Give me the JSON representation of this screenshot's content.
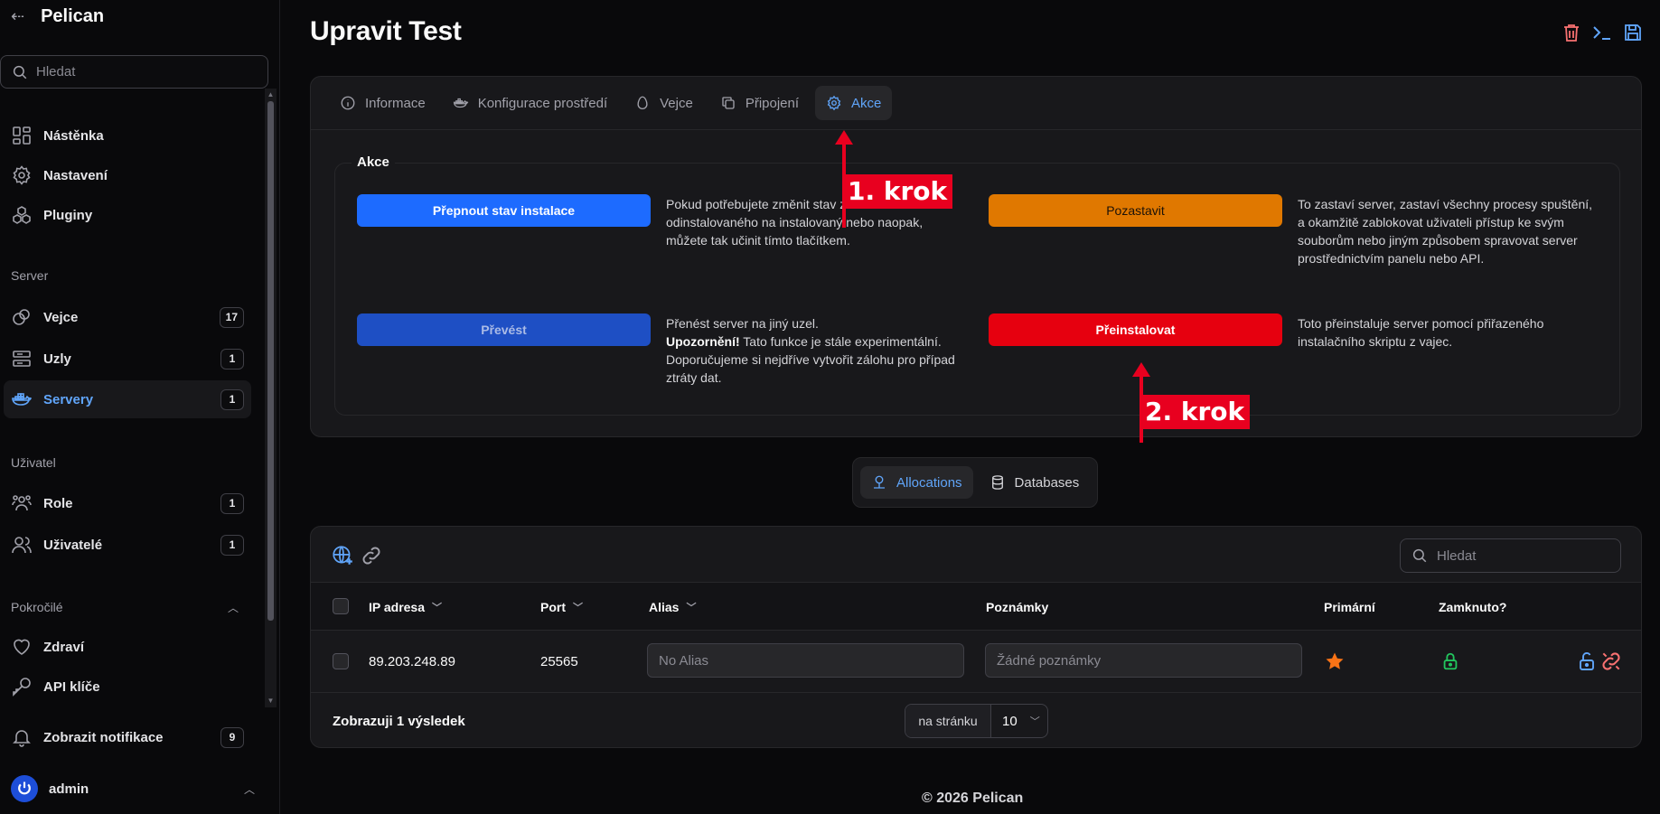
{
  "app": {
    "name": "Pelican"
  },
  "sidebar": {
    "search_placeholder": "Hledat",
    "items_top": [
      {
        "label": "Nástěnka",
        "icon": "dashboard-icon"
      },
      {
        "label": "Nastavení",
        "icon": "gear-icon"
      },
      {
        "label": "Pluginy",
        "icon": "plugins-icon"
      }
    ],
    "group_server": "Server",
    "items_server": [
      {
        "label": "Vejce",
        "badge": "17",
        "icon": "egg-icon"
      },
      {
        "label": "Uzly",
        "badge": "1",
        "icon": "server-stack-icon"
      },
      {
        "label": "Servery",
        "badge": "1",
        "icon": "docker-icon",
        "active": true
      }
    ],
    "group_user": "Uživatel",
    "items_user": [
      {
        "label": "Role",
        "badge": "1",
        "icon": "roles-icon"
      },
      {
        "label": "Uživatelé",
        "badge": "1",
        "icon": "users-icon"
      }
    ],
    "group_advanced": "Pokročilé",
    "items_advanced": [
      {
        "label": "Zdraví",
        "icon": "heart-icon"
      },
      {
        "label": "API klíče",
        "icon": "key-icon"
      }
    ],
    "notifications": {
      "label": "Zobrazit notifikace",
      "badge": "9"
    },
    "user": {
      "name": "admin"
    }
  },
  "page": {
    "title": "Upravit Test"
  },
  "tabs": [
    {
      "label": "Informace",
      "icon": "info-icon"
    },
    {
      "label": "Konfigurace prostředí",
      "icon": "docker-icon"
    },
    {
      "label": "Vejce",
      "icon": "egg-icon"
    },
    {
      "label": "Připojení",
      "icon": "copy-icon"
    },
    {
      "label": "Akce",
      "icon": "gear-icon",
      "active": true
    }
  ],
  "actions": {
    "legend": "Akce",
    "toggle_install": {
      "label": "Přepnout stav instalace",
      "desc": "Pokud potřebujete změnit stav z odinstalovaného na instalovaný nebo naopak, můžete tak učinit tímto tlačítkem."
    },
    "suspend": {
      "label": "Pozastavit",
      "desc": "To zastaví server, zastaví všechny procesy spuštění, a okamžitě zablokovat uživateli přístup ke svým souborům nebo jiným způsobem spravovat server prostřednictvím panelu nebo API."
    },
    "transfer": {
      "label": "Převést",
      "desc_line1": "Přenést server na jiný uzel.",
      "desc_warn": "Upozornění!",
      "desc_rest": " Tato funkce je stále experimentální. Doporučujeme si nejdříve vytvořit zálohu pro případ ztráty dat."
    },
    "reinstall": {
      "label": "Přeinstalovat",
      "desc": "Toto přeinstaluje server pomocí přiřazeného instalačního skriptu z vajec."
    }
  },
  "annotations": {
    "step1": "1. krok",
    "step2": "2. krok"
  },
  "relations": [
    {
      "label": "Allocations",
      "icon": "network-icon",
      "active": true
    },
    {
      "label": "Databases",
      "icon": "database-icon"
    }
  ],
  "table": {
    "search_placeholder": "Hledat",
    "columns": [
      "IP adresa",
      "Port",
      "Alias",
      "Poznámky",
      "Primární",
      "Zamknuto?"
    ],
    "rows": [
      {
        "ip": "89.203.248.89",
        "port": "25565",
        "alias_placeholder": "No Alias",
        "notes_placeholder": "Žádné poznámky",
        "primary": true,
        "locked": true
      }
    ],
    "results_text": "Zobrazuji 1 výsledek",
    "per_page_label": "na stránku",
    "per_page_value": "10"
  },
  "footer": "© 2026 Pelican",
  "colors": {
    "accent": "#60a5fa",
    "btn_blue": "#1d6bff",
    "btn_orange": "#e07800",
    "btn_transfer": "#1e4fc4",
    "btn_red": "#e6000f",
    "annotation": "#e8001f"
  }
}
